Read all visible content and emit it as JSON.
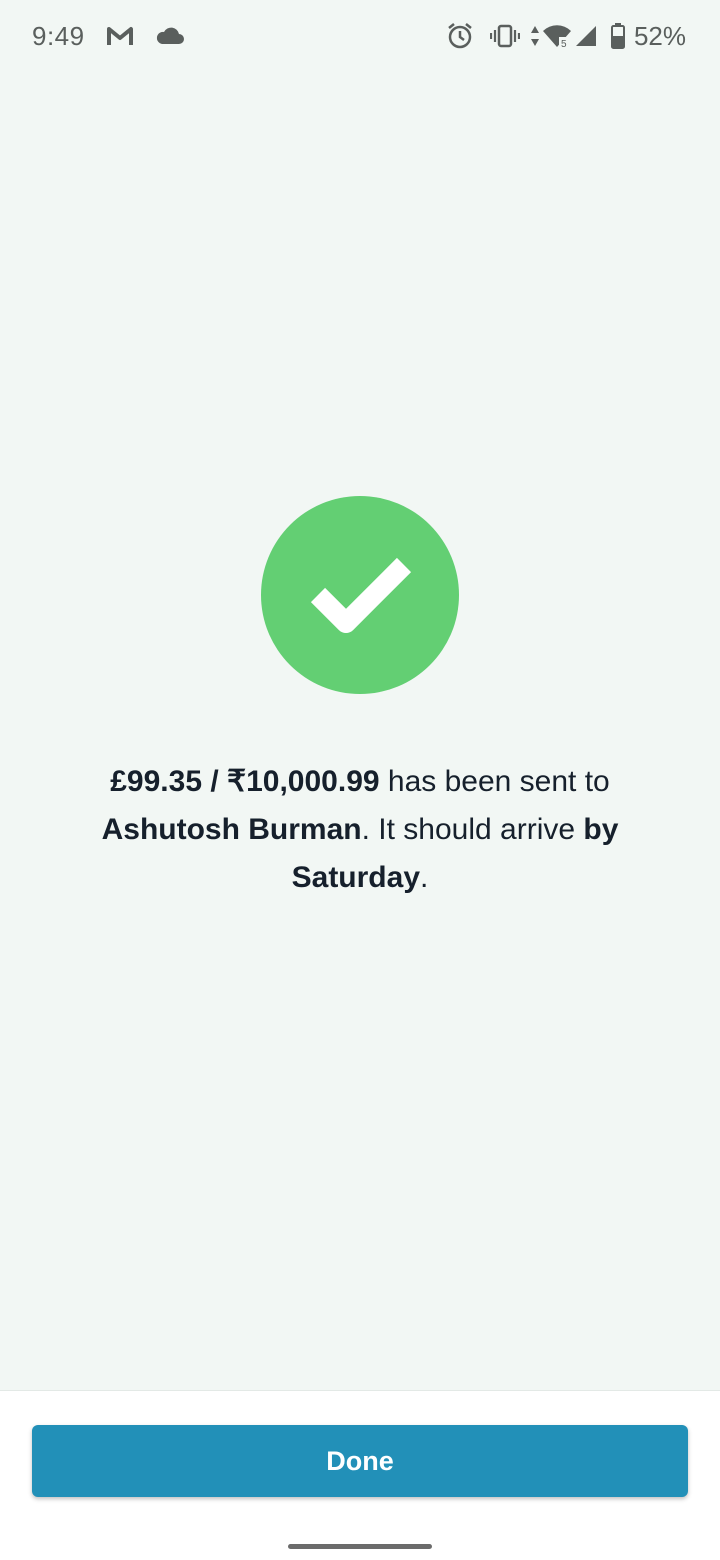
{
  "status_bar": {
    "time": "9:49",
    "battery": "52%",
    "left_icons": [
      "gmail-icon",
      "cloud-icon"
    ],
    "right_icons": [
      "alarm-icon",
      "vibrate-icon",
      "data-arrows-icon",
      "wifi-icon",
      "signal-icon",
      "battery-icon"
    ],
    "wifi_badge": "5"
  },
  "confirmation": {
    "icon": "check-icon",
    "amount": "£99.35 / ₹10,000.99",
    "text_sent": " has been sent to ",
    "recipient": "Ashutosh Burman",
    "text_arrive": ". It should arrive ",
    "arrival": "by Saturday",
    "text_end": "."
  },
  "actions": {
    "done_label": "Done"
  },
  "colors": {
    "background": "#f2f7f4",
    "success": "#63cf73",
    "button": "#2290b8"
  }
}
